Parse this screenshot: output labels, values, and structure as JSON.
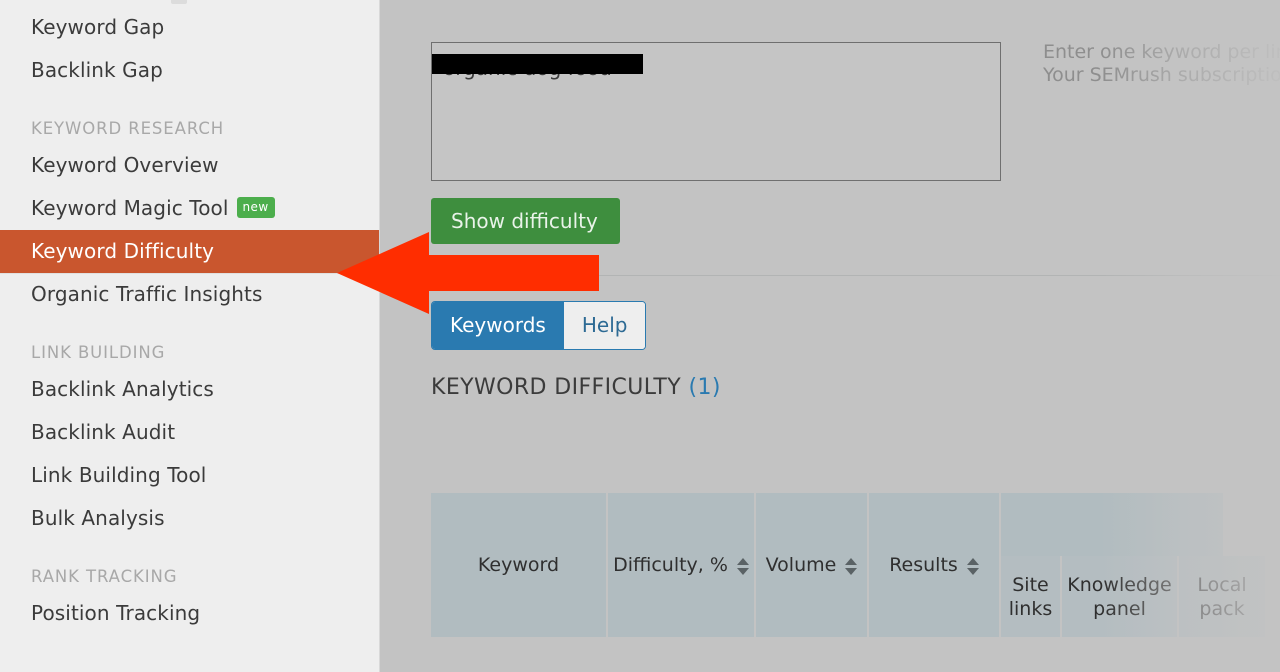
{
  "sidebar": {
    "items_top": [
      {
        "label": "Keyword Gap",
        "type": "item"
      },
      {
        "label": "Backlink Gap",
        "type": "item"
      }
    ],
    "groups": [
      {
        "title": "KEYWORD RESEARCH",
        "items": [
          {
            "label": "Keyword Overview",
            "badge": ""
          },
          {
            "label": "Keyword Magic Tool",
            "badge": "new"
          },
          {
            "label": "Keyword Difficulty",
            "badge": "",
            "active": true
          },
          {
            "label": "Organic Traffic Insights",
            "badge": ""
          }
        ]
      },
      {
        "title": "LINK BUILDING",
        "items": [
          {
            "label": "Backlink Analytics",
            "badge": ""
          },
          {
            "label": "Backlink Audit",
            "badge": ""
          },
          {
            "label": "Link Building Tool",
            "badge": ""
          },
          {
            "label": "Bulk Analysis",
            "badge": ""
          }
        ]
      },
      {
        "title": "RANK TRACKING",
        "items": [
          {
            "label": "Position Tracking",
            "badge": ""
          }
        ]
      }
    ]
  },
  "main": {
    "keyword_input": {
      "value": "organic dog food",
      "redacted": true
    },
    "hint_line_1": "Enter one keyword per line",
    "hint_line_2": "Your SEMrush subscription",
    "show_difficulty_button": "Show difficulty",
    "tabs": [
      {
        "label": "Keywords",
        "active": true
      },
      {
        "label": "Help",
        "active": false
      }
    ],
    "section_title": "KEYWORD DIFFICULTY",
    "section_count": "(1)",
    "table": {
      "columns": [
        {
          "label": "Keyword",
          "sortable": false
        },
        {
          "label": "Difficulty, %",
          "sortable": true
        },
        {
          "label": "Volume",
          "sortable": true
        },
        {
          "label": "Results",
          "sortable": true
        }
      ],
      "serp_features": [
        {
          "line1": "Site",
          "line2": "links"
        },
        {
          "line1": "Knowledge",
          "line2": "panel"
        },
        {
          "line1": "Local",
          "line2": "pack"
        }
      ]
    }
  },
  "colors": {
    "accent_active_nav": "#c9562e",
    "primary_button": "#3e8e3e",
    "tab_active": "#2a7ab0",
    "badge_new": "#4cae4c",
    "annotation_arrow": "#ff2d00",
    "table_header": "#b1bcc0"
  },
  "annotation": {
    "arrow_label": "points-to-keyword-difficulty"
  }
}
